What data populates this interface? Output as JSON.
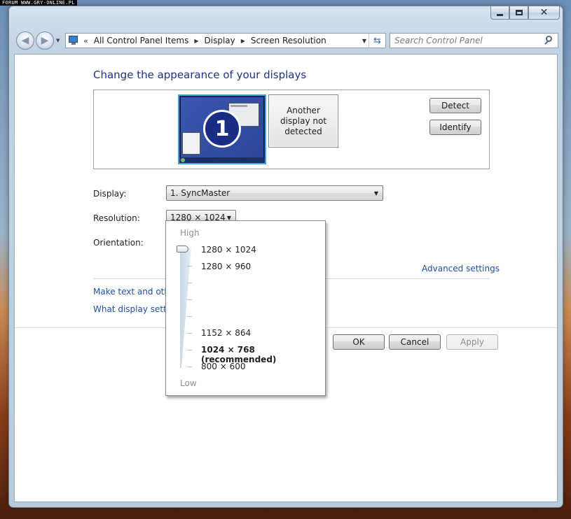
{
  "watermark": "FORUM WWW.GRY-ONLINE.PL",
  "address": {
    "lead": "«",
    "crumbs": [
      "All Control Panel Items",
      "Display",
      "Screen Resolution"
    ]
  },
  "search": {
    "placeholder": "Search Control Panel"
  },
  "page": {
    "title": "Change the appearance of your displays"
  },
  "preview": {
    "display_number": "1",
    "another_display_text": "Another display not detected",
    "detect_label": "Detect",
    "identify_label": "Identify"
  },
  "settings": {
    "display_label": "Display:",
    "display_value": "1. SyncMaster",
    "resolution_label": "Resolution:",
    "resolution_value": "1280 × 1024",
    "orientation_label": "Orientation:"
  },
  "links": {
    "advanced": "Advanced settings",
    "make_text": "Make text and other",
    "what_display": "What display setting"
  },
  "buttons": {
    "ok": "OK",
    "cancel": "Cancel",
    "apply": "Apply"
  },
  "resolution_popup": {
    "high_label": "High",
    "low_label": "Low",
    "options": [
      "1280 × 1024",
      "1280 × 960",
      "1152 × 864",
      "1024 × 768 (recommended)",
      "800 × 600"
    ],
    "selected_index": 0,
    "recommended_index": 3
  },
  "colors": {
    "title_blue": "#1e3287",
    "link_blue": "#1f4fa8",
    "monitor_active_border": "#3fa6e6"
  }
}
